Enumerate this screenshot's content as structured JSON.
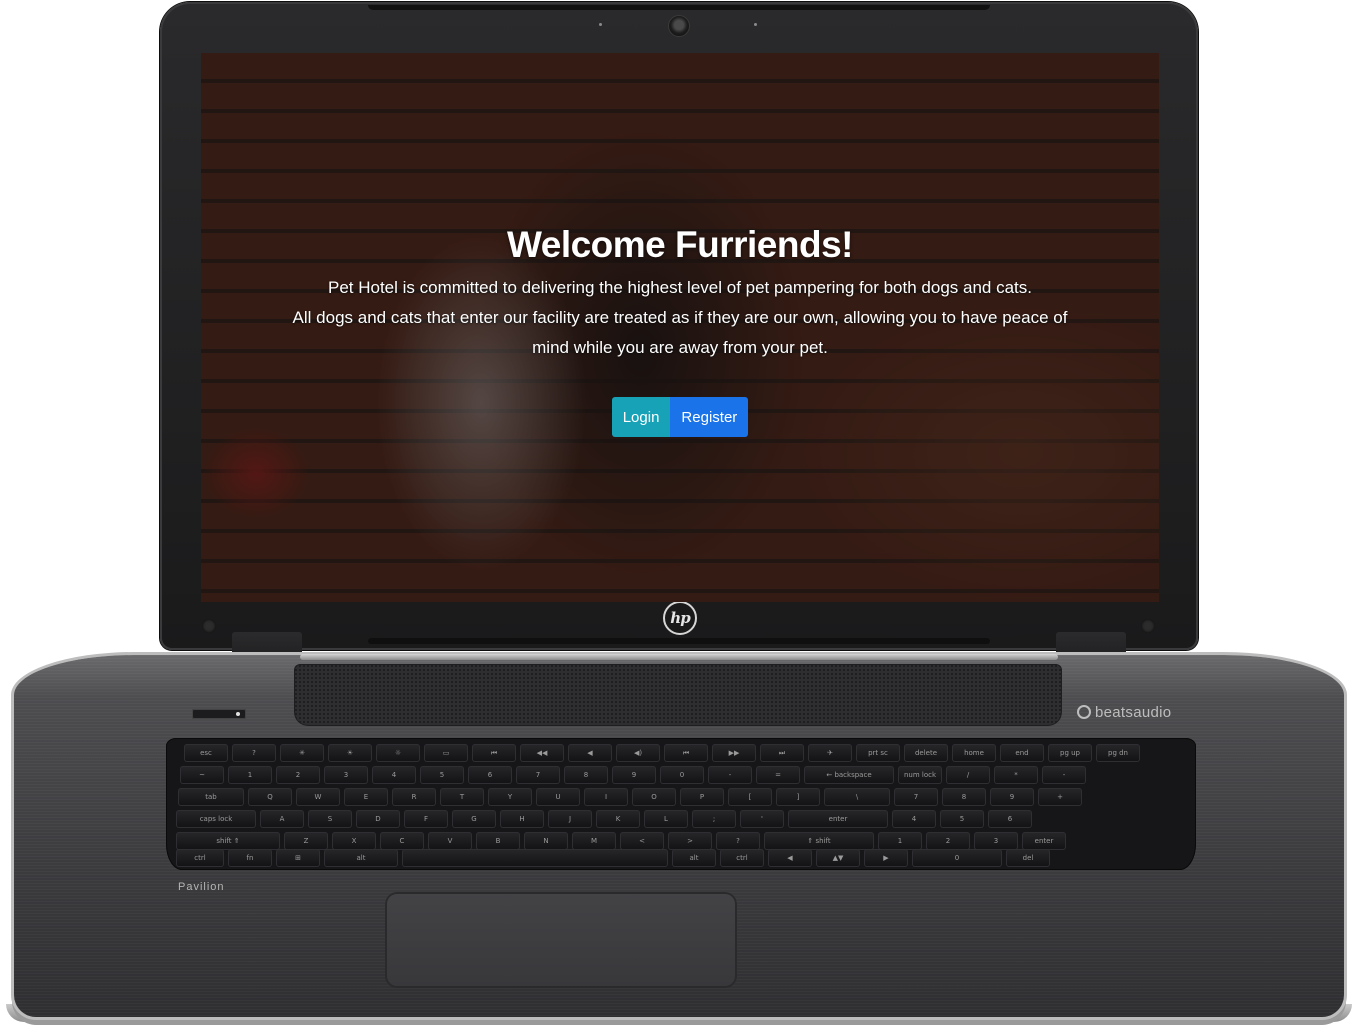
{
  "device": {
    "brand_logo": "hp",
    "audio_brand": "beatsaudio",
    "model_label": "Pavilion"
  },
  "hero": {
    "title": "Welcome Furriends!",
    "line1": "Pet Hotel is committed to delivering the highest level of pet pampering for both dogs and cats.",
    "line2": "All dogs and cats that enter our facility are treated as if they are our own, allowing you to have peace of mind while you are away from your pet.",
    "background_description": "dog-close-up-on-brick-background"
  },
  "actions": {
    "login_label": "Login",
    "register_label": "Register",
    "login_color": "#17a2b8",
    "register_color": "#1a73e8"
  },
  "keyboard": {
    "row1": [
      "esc",
      "?",
      "✳",
      "☀",
      "☼",
      "▭",
      "⏮",
      "◀◀",
      "◀",
      "◀)",
      "⏮",
      "▶▶",
      "⏭",
      "✈",
      "prt sc",
      "delete",
      "home",
      "end",
      "pg up",
      "pg dn"
    ],
    "row2": [
      "~",
      "1",
      "2",
      "3",
      "4",
      "5",
      "6",
      "7",
      "8",
      "9",
      "0",
      "-",
      "=",
      "← backspace",
      "num lock",
      "/",
      "*",
      "-"
    ],
    "row3": [
      "tab",
      "Q",
      "W",
      "E",
      "R",
      "T",
      "Y",
      "U",
      "I",
      "O",
      "P",
      "[",
      "]",
      "\\",
      "7",
      "8",
      "9",
      "+"
    ],
    "row4": [
      "caps lock",
      "A",
      "S",
      "D",
      "F",
      "G",
      "H",
      "J",
      "K",
      "L",
      ";",
      "'",
      "enter",
      "4",
      "5",
      "6"
    ],
    "row5": [
      "shift ⇑",
      "Z",
      "X",
      "C",
      "V",
      "B",
      "N",
      "M",
      "<",
      ">",
      "?",
      "⇑ shift",
      "1",
      "2",
      "3",
      "enter"
    ],
    "row6": [
      "ctrl",
      "fn",
      "⊞",
      "alt",
      "",
      "alt",
      "ctrl",
      "◀",
      "▲▼",
      "▶",
      "0",
      "del"
    ]
  }
}
